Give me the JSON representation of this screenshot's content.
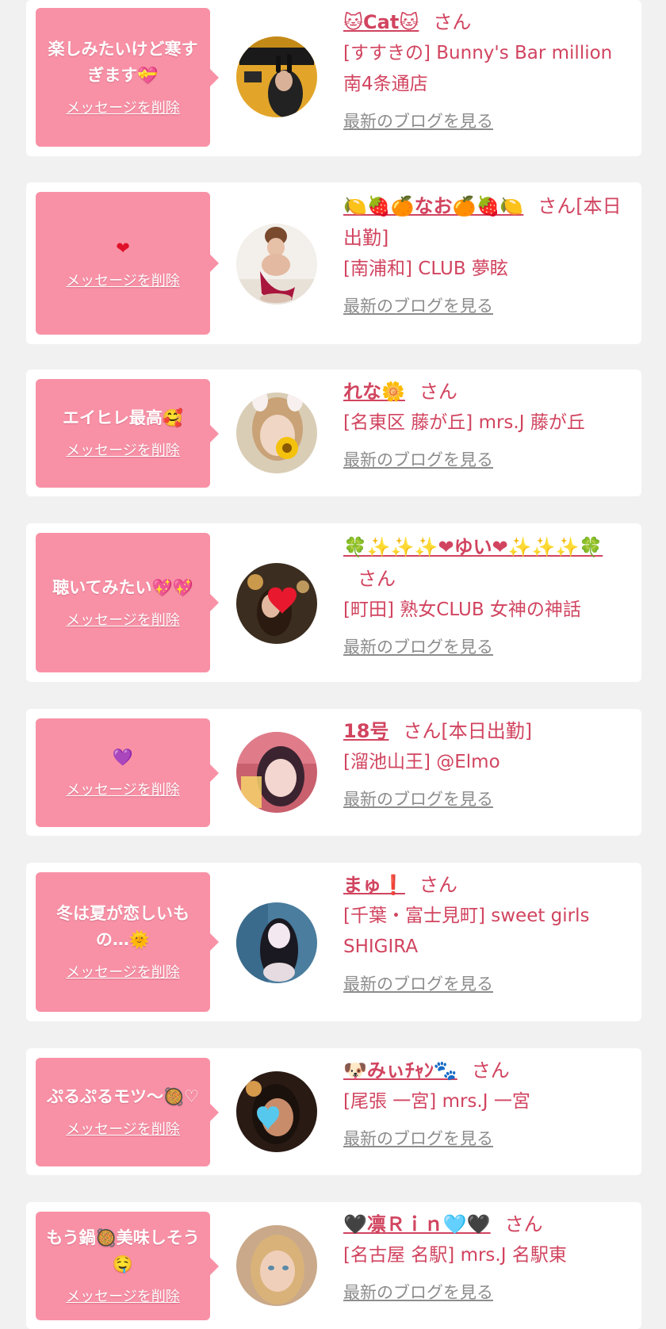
{
  "delete_label": "メッセージを削除",
  "blog_label": "最新のブログを見る",
  "items": [
    {
      "message": "楽しみたいけど寒すぎます💝",
      "name": "🐱Cat🐱",
      "suffix": "さん",
      "shop": "[すすきの] Bunny's Bar million 南4条通店"
    },
    {
      "message": "❤",
      "name": "🍋🍓🍊なお🍊🍓🍋",
      "suffix": "さん[本日出勤]",
      "shop": "[南浦和] CLUB 夢眩"
    },
    {
      "message": "エイヒレ最高🥰",
      "name": "れな🌼",
      "suffix": "さん",
      "shop": "[名東区 藤が丘] mrs.J 藤が丘"
    },
    {
      "message": "聴いてみたい💖💖",
      "name": "🍀✨✨✨❤ゆい❤✨✨✨🍀",
      "suffix": "さん",
      "shop": "[町田] 熟女CLUB 女神の神話"
    },
    {
      "message": "💜",
      "name": "18号",
      "suffix": "さん[本日出勤]",
      "shop": "[溜池山王] @Elmo"
    },
    {
      "message": "冬は夏が恋しいもの…🌞",
      "name": "まゅ❗",
      "suffix": "さん",
      "shop": "[千葉・富士見町] sweet girls SHIGIRA"
    },
    {
      "message": "ぷるぷるモツ〜🥘♡",
      "name": "🐶みぃﾁｬﾝ🐾",
      "suffix": "さん",
      "shop": "[尾張 一宮] mrs.J 一宮"
    },
    {
      "message": "もう鍋🥘美味しそう🤤",
      "name": "🖤凛Ｒｉｎ🩵🖤",
      "suffix": "さん",
      "shop": "[名古屋 名駅] mrs.J 名駅東"
    }
  ]
}
